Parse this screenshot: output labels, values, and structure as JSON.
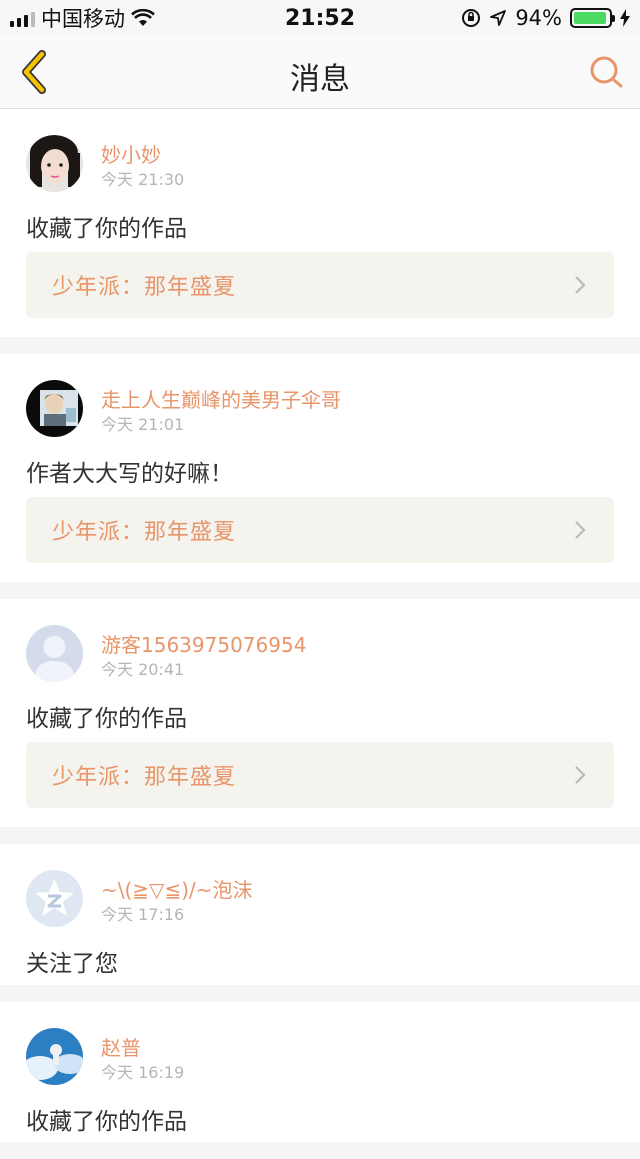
{
  "status": {
    "carrier": "中国移动",
    "time": "21:52",
    "battery_percent": "94%",
    "battery_level": 0.94,
    "icons": [
      "signal-icon",
      "wifi-icon",
      "orientation-lock-icon",
      "location-icon",
      "battery-icon",
      "charging-icon"
    ]
  },
  "nav": {
    "title": "消息",
    "back_icon": "chevron-left-icon",
    "search_icon": "search-icon"
  },
  "colors": {
    "accent": "#e8956a",
    "back": "#f5c400"
  },
  "messages": [
    {
      "user": "妙小妙",
      "time": "今天 21:30",
      "text": "收藏了你的作品",
      "work": "少年派：那年盛夏",
      "avatar": "avatar-girl"
    },
    {
      "user": "走上人生巅峰的美男子伞哥",
      "time": "今天 21:01",
      "text": "作者大大写的好嘛！",
      "work": "少年派：那年盛夏",
      "avatar": "avatar-photo"
    },
    {
      "user": "游客1563975076954",
      "time": "今天 20:41",
      "text": "收藏了你的作品",
      "work": "少年派：那年盛夏",
      "avatar": "avatar-default"
    },
    {
      "user": "~\\(≧▽≦)/~泡沫",
      "time": "今天 17:16",
      "text": "关注了您",
      "avatar": "avatar-qzone"
    },
    {
      "user": "赵普",
      "time": "今天 16:19",
      "text": "收藏了你的作品",
      "avatar": "avatar-sky"
    }
  ]
}
